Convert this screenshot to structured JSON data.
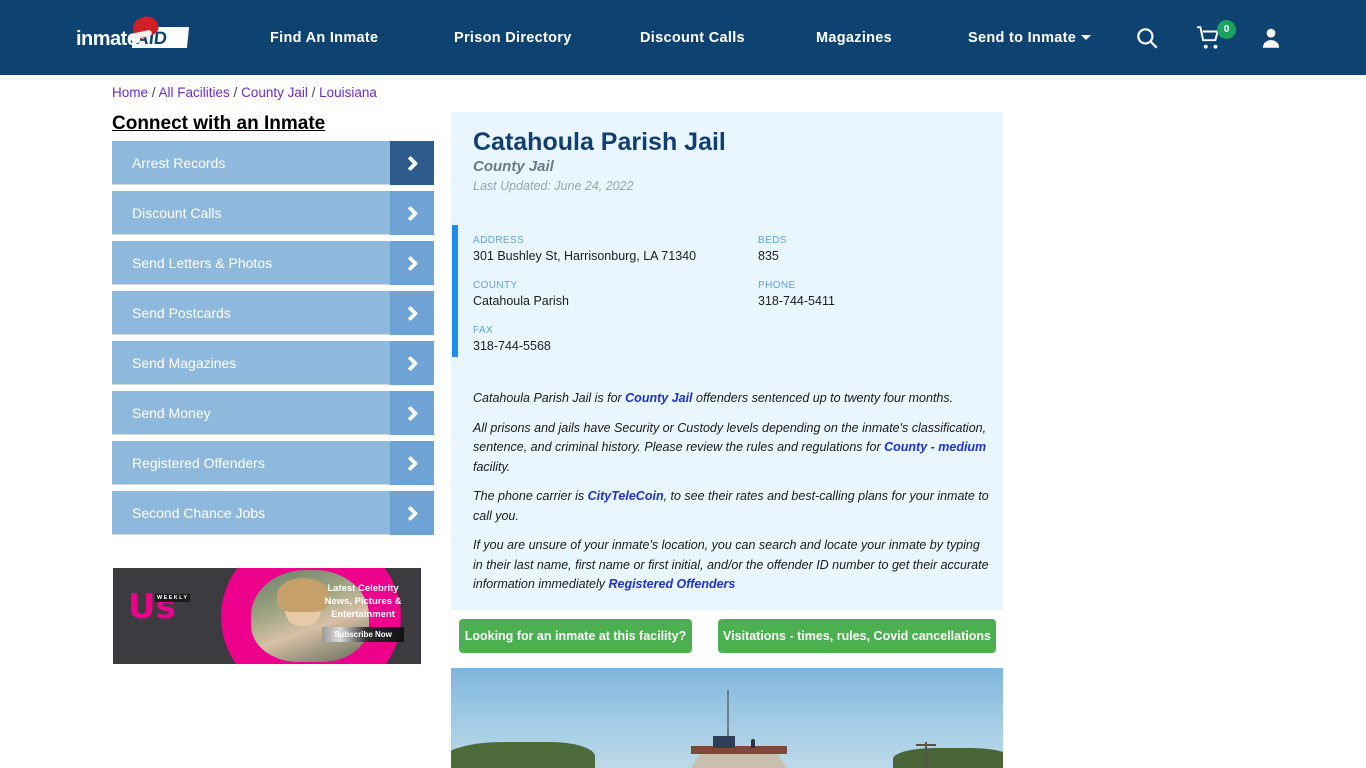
{
  "header": {
    "logo_text": "inmate",
    "logo_accent": "AID",
    "logo_sub": "santa-hat",
    "nav": [
      {
        "label": "Find An Inmate"
      },
      {
        "label": "Prison Directory"
      },
      {
        "label": "Discount Calls"
      },
      {
        "label": "Magazines"
      },
      {
        "label": "Send to Inmate"
      }
    ],
    "icons": {
      "search": "search-icon",
      "cart": "cart-icon",
      "user": "user-icon"
    },
    "cart_count": "0",
    "bg_color": "#0e4371",
    "badge_color": "#1aa260"
  },
  "breadcrumb": {
    "items": [
      {
        "label": "Home"
      },
      {
        "label": "All Facilities"
      },
      {
        "label": "County Jail"
      },
      {
        "label": "Louisiana"
      }
    ],
    "separator": "/",
    "link_color": "#6c2dc7"
  },
  "sidebar": {
    "title": "Connect with an Inmate",
    "items": [
      {
        "label": "Arrest Records",
        "active": true
      },
      {
        "label": "Discount Calls",
        "active": false
      },
      {
        "label": "Send Letters & Photos",
        "active": false
      },
      {
        "label": "Send Postcards",
        "active": false
      },
      {
        "label": "Send Magazines",
        "active": false
      },
      {
        "label": "Send Money",
        "active": false
      },
      {
        "label": "Registered Offenders",
        "active": false
      },
      {
        "label": "Second Chance Jobs",
        "active": false
      }
    ]
  },
  "ad": {
    "brand": "Us",
    "brand_sub": "WEEKLY",
    "line1": "Latest Celebrity",
    "line2": "News, Pictures &",
    "line3": "Entertainment",
    "cta": "Subscribe Now"
  },
  "facility": {
    "name": "Catahoula Parish Jail",
    "type": "County Jail",
    "last_updated": "Last Updated: June 24, 2022",
    "fields": {
      "address_label": "ADDRESS",
      "address_value": "301 Bushley St, Harrisonburg, LA 71340",
      "county_label": "COUNTY",
      "county_value": "Catahoula Parish",
      "fax_label": "FAX",
      "fax_value": "318-744-5568",
      "beds_label": "BEDS",
      "beds_value": "835",
      "phone_label": "PHONE",
      "phone_value": "318-744-5411"
    },
    "paragraphs": {
      "p1_a": "Catahoula Parish Jail is for ",
      "p1_link": "County Jail",
      "p1_b": " offenders sentenced up to twenty four months.",
      "p2_a": "All prisons and jails have Security or Custody levels depending on the inmate's classification, sentence, and criminal history. Please review the rules and regulations for ",
      "p2_link": "County - medium",
      "p2_b": " facility.",
      "p3_a": "The phone carrier is ",
      "p3_link": "CityTeleCoin",
      "p3_b": ", to see their rates and best-calling plans for your inmate to call you.",
      "p4_a": "If you are unsure of your inmate's location, you can search and locate your inmate by typing in their last name, first name or first initial, and/or the offender ID number to get their accurate information immediately ",
      "p4_link": "Registered Offenders"
    },
    "accent_color": "#1f8ce8",
    "card_bg": "#eaf6ff"
  },
  "actions": {
    "inmate_search": "Looking for an inmate at this facility?",
    "visitations": "Visitations - times, rules, Covid cancellations",
    "color": "#4caf50"
  },
  "photo": {
    "alt": "facility-exterior-photo"
  }
}
